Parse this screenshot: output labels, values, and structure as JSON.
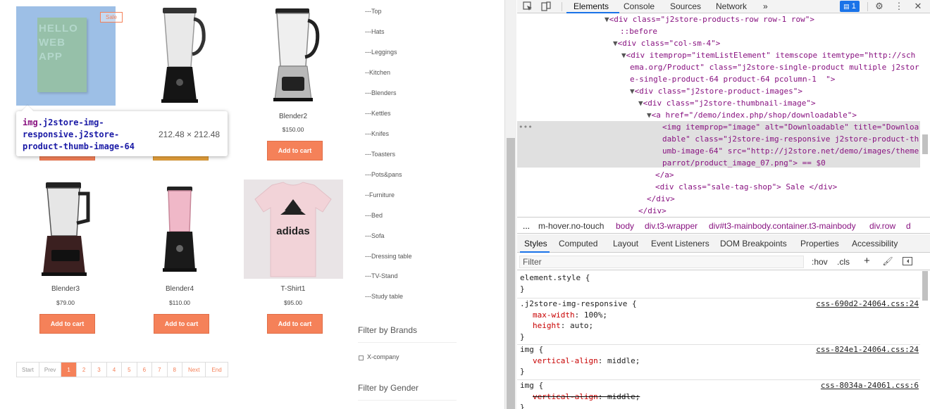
{
  "site": {
    "products": [
      {
        "name": "",
        "price": "",
        "button": "Add to cart",
        "badge": "Sale",
        "image": "downloadable-book-image"
      },
      {
        "name": "",
        "price": "",
        "button": "",
        "image": "blender-image"
      },
      {
        "name": "Blender2",
        "price": "$150.00",
        "button": "Add to cart",
        "image": "blender2-image"
      },
      {
        "name": "Blender3",
        "price": "$79.00",
        "button": "Add to cart",
        "image": "blender3-image"
      },
      {
        "name": "Blender4",
        "price": "$110.00",
        "button": "Add to cart",
        "image": "blender4-image"
      },
      {
        "name": "T-Shirt1",
        "price": "$95.00",
        "button": "Add to cart",
        "image": "tshirt-image"
      }
    ],
    "book_cover_text": "HELLO WEB APP",
    "tshirt_text": "adidas",
    "categories": [
      "---Top",
      "---Hats",
      "---Leggings",
      "--Kitchen",
      "---Blenders",
      "---Kettles",
      "---Knifes",
      "---Toasters",
      "---Pots&pans",
      "--Furniture",
      "---Bed",
      "---Sofa",
      "---Dressing table",
      "---TV-Stand",
      "---Study table"
    ],
    "filter_brands_title": "Filter by Brands",
    "brand_option": "X-company",
    "filter_gender_title": "Filter by Gender",
    "pagination": [
      "Start",
      "Prev",
      "1",
      "2",
      "3",
      "4",
      "5",
      "6",
      "7",
      "8",
      "Next",
      "End"
    ],
    "tooltip": {
      "selector_tag": "img",
      "selector_class": ".j2store-img-responsive.j2store-product-thumb-image-64",
      "size": "212.48 × 212.48"
    }
  },
  "devtools": {
    "tabs": [
      "Elements",
      "Console",
      "Sources",
      "Network",
      "»"
    ],
    "issues_count": "1",
    "dom_lines": [
      "<div class=\"j2store-products-row row-1 row\">",
      "::before",
      "<div class=\"col-sm-4\">",
      "<div itemprop=\"itemListElement\" itemscope itemtype=\"http://sch",
      "ema.org/Product\" class=\"j2store-single-product multiple j2stor",
      "e-single-product-64 product-64 pcolumn-1  \">",
      "<div class=\"j2store-product-images\">",
      "<div class=\"j2store-thumbnail-image\">",
      "<a href=\"/demo/index.php/shop/downloadable\">",
      "<img itemprop=\"image\" alt=\"Downloadable\" title=\"Downloa",
      "dable\" class=\"j2store-img-responsive j2store-product-th",
      "umb-image-64\" src=\"http://j2store.net/demo/images/theme",
      "parrot/product_image_07.png\"> == $0",
      "</a>",
      "<div class=\"sale-tag-shop\"> Sale </div>",
      "</div>",
      "</div>"
    ],
    "breadcrumbs": [
      "...",
      "m-hover.no-touch",
      "body",
      "div.t3-wrapper",
      "div#t3-mainbody.container.t3-mainbody",
      "div.row",
      "d"
    ],
    "style_tabs": [
      "Styles",
      "Computed",
      "Layout",
      "Event Listeners",
      "DOM Breakpoints",
      "Properties",
      "Accessibility"
    ],
    "filter_placeholder": "Filter",
    "filter_buttons": [
      ":hov",
      ".cls",
      "+"
    ],
    "rules": [
      {
        "selector": "element.style {",
        "close": "}",
        "props": [],
        "source": ""
      },
      {
        "selector": ".j2store-img-responsive {",
        "close": "}",
        "props": [
          {
            "name": "max-width",
            "value": "100%;"
          },
          {
            "name": "height",
            "value": "auto;"
          }
        ],
        "source": "css-690d2-24064.css:24"
      },
      {
        "selector": "img {",
        "close": "}",
        "props": [
          {
            "name": "vertical-align",
            "value": "middle;"
          }
        ],
        "source": "css-824e1-24064.css:24"
      },
      {
        "selector": "img {",
        "close": "}",
        "props": [
          {
            "name": "vertical-align",
            "value": "middle;",
            "struck": true
          }
        ],
        "source": "css-8034a-24061.css:6"
      }
    ]
  }
}
